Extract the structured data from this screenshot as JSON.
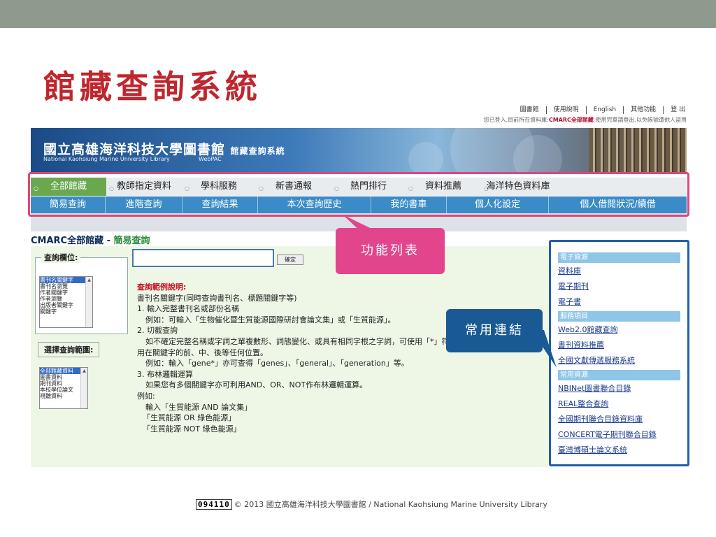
{
  "slide": {
    "title": "館藏查詢系統"
  },
  "toplinks": {
    "items": [
      "圖書館",
      "使用說明",
      "English",
      "其他功能",
      "登 出"
    ],
    "status_prefix": "您已登入,目前所在資料庫:",
    "status_db": "CMARC全部館藏",
    "status_suffix": " 使用完畢請登出,以免帳號遭他人盜用"
  },
  "banner": {
    "library_cn": "國立高雄海洋科技大學圖書館",
    "system_cn": "館藏查詢系統",
    "library_en": "National Kaohsiung Marine University Library",
    "webpac": "WebPAC"
  },
  "nav_primary": [
    {
      "label": "全部館藏",
      "active": true
    },
    {
      "label": "教師指定資料",
      "active": false
    },
    {
      "label": "學科服務",
      "active": false
    },
    {
      "label": "新書通報",
      "active": false
    },
    {
      "label": "熱門排行",
      "active": false
    },
    {
      "label": "資料推薦",
      "active": false
    },
    {
      "label": "海洋特色資料庫",
      "active": false
    }
  ],
  "nav_secondary": [
    "簡易查詢",
    "進階查詢",
    "查詢結果",
    "本次查詢歷史",
    "我的書車",
    "個人化設定",
    "個人借閱狀況/續借"
  ],
  "breadcrumb": {
    "db": "CMARC全部館藏 - ",
    "page": "簡易查詢"
  },
  "search": {
    "field_legend": "查詢欄位:",
    "field_options": [
      "書刊名關鍵字",
      "書刊名瀏覽",
      "作者關鍵字",
      "作者瀏覽",
      "出版者關鍵字",
      "關鍵字"
    ],
    "scope_legend": "選擇查詢範圍:",
    "scope_options": [
      "全部館藏資料",
      "圖書資料",
      "期刊資料",
      "本校學位論文",
      "視聽資料"
    ],
    "input_value": "",
    "submit_label": "確定"
  },
  "help": {
    "title": "查詢範例說明:",
    "lines": [
      "書刊名關鍵字(同時查詢書刊名、標題關鍵字等)",
      "1. 輸入完整書刊名或部份名稱",
      "例如：可輸入「生物催化暨生質能源國際研討會論文集」或「生質能源」。",
      "2. 切截查詢",
      "如不確定完整名稱或字詞之單複數形、詞態變化、或具有相同字根之字詞，可使用「*」符號查詢，「*」符號可使",
      "用在關鍵字的前、中、後等任何位置。",
      "例如：輸入「gene*」亦可查得「genes」、「general」、「generation」等。",
      "3. 布林邏輯運算",
      "如果您有多個關鍵字亦可利用AND、OR、NOT作布林邏輯運算。",
      "例如:",
      "輸入「生質能源 AND 論文集」",
      "「生質能源 OR 綠色能源」",
      "「生質能源 NOT 綠色能源」"
    ]
  },
  "callouts": {
    "nav": "功能列表",
    "links": "常用連結"
  },
  "right_panel": {
    "sections": [
      {
        "header": "電子資源",
        "links": [
          "資料庫",
          "電子期刊",
          "電子書"
        ]
      },
      {
        "header": "服務項目",
        "links": [
          "Web2.0館藏查詢",
          "書刊資料推薦",
          "全國文獻傳遞服務系統"
        ]
      },
      {
        "header": "常用資源",
        "links": [
          "NBINet圖書聯合目錄",
          "REAL整合查詢",
          "全國期刊聯合目錄資料庫",
          "CONCERT電子期刊聯合目錄",
          "臺灣博碩士論文系統"
        ]
      }
    ]
  },
  "footer": {
    "counter": "094110",
    "copyright": "© 2013 國立高雄海洋科技大學圖書館 / National Kaohsiung Marine University Library"
  },
  "colors": {
    "title": "#c0262d",
    "nav_active": "#6aa84f",
    "nav_secondary": "#3a8bc7",
    "callout_nav": "#e2458b",
    "callout_links": "#1a5a94",
    "highlight_outline": "#e0457b"
  }
}
